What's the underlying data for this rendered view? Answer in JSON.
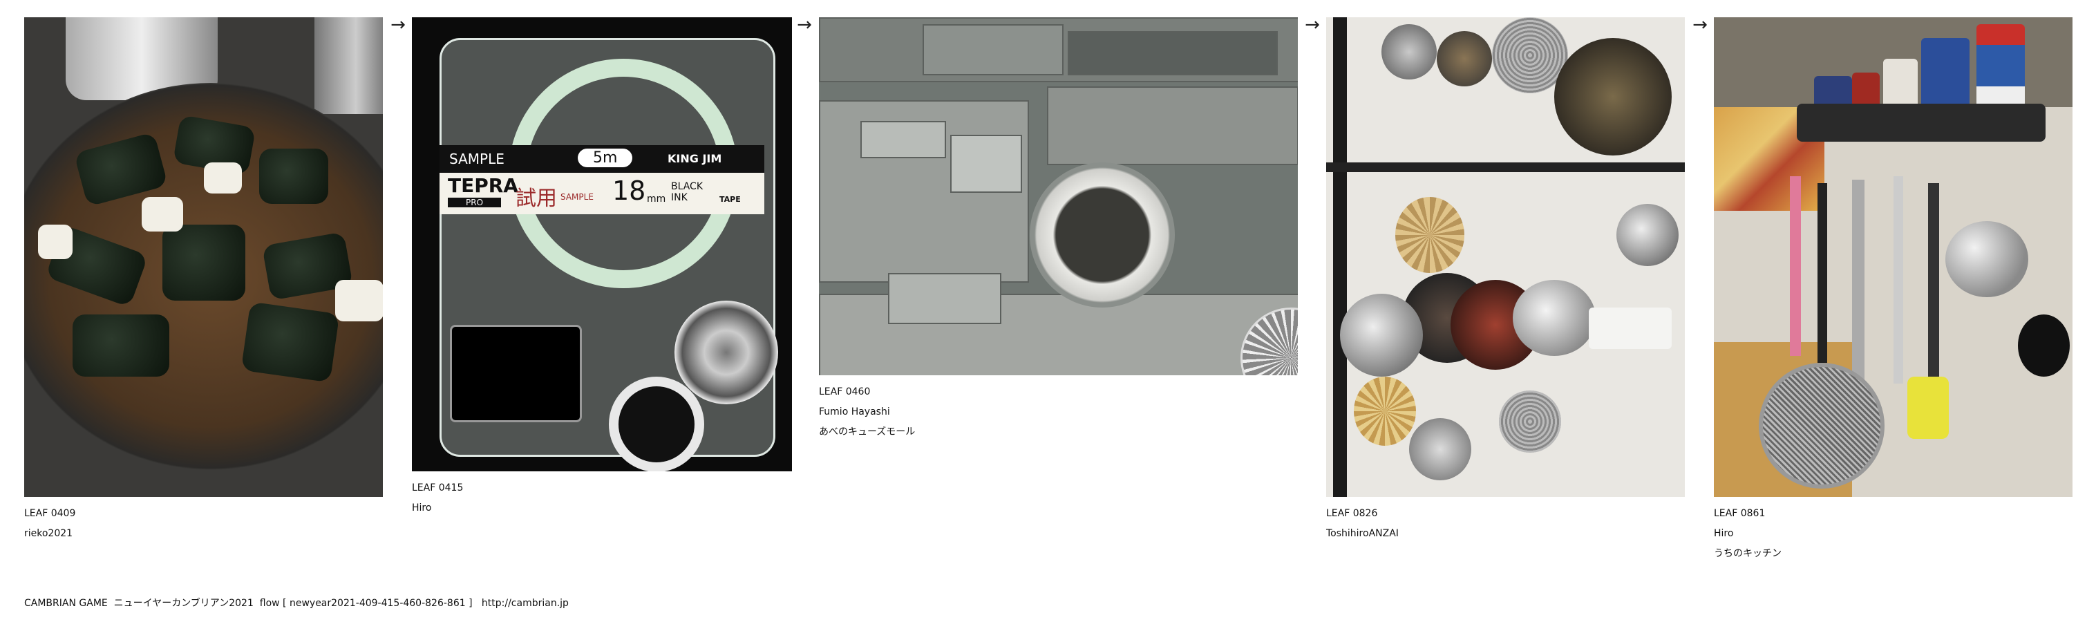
{
  "leaves": [
    {
      "id": "LEAF 0409",
      "author": "rieko2021",
      "place": ""
    },
    {
      "id": "LEAF 0415",
      "author": "Hiro",
      "place": ""
    },
    {
      "id": "LEAF 0460",
      "author": "Fumio Hayashi",
      "place": "あべのキューズモール"
    },
    {
      "id": "LEAF 0826",
      "author": "ToshihiroANZAI",
      "place": ""
    },
    {
      "id": "LEAF 0861",
      "author": "Hiro",
      "place": "うちのキッチン"
    }
  ],
  "arrow": "→",
  "tape_label": {
    "sample": "SAMPLE",
    "length": "5m",
    "brand": "KING JIM",
    "logo": "TEPRA",
    "logo_sub": "PRO",
    "trial": "試用",
    "trial_sub": "SAMPLE",
    "width_num": "18",
    "width_unit": "mm",
    "ink": "BLACK INK",
    "tape": "TAPE"
  },
  "footer": {
    "text": "CAMBRIAN GAME  ニューイヤーカンブリアン2021  flow [ newyear2021-409-415-460-826-861 ]   ",
    "link": "http://cambrian.jp"
  }
}
